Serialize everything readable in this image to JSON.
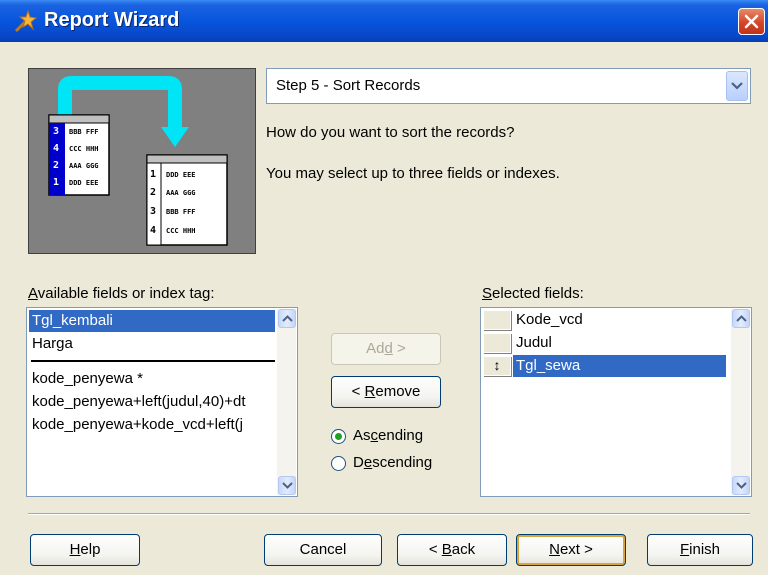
{
  "window": {
    "title": "Report Wizard"
  },
  "step_select": {
    "value": "Step 5 - Sort Records"
  },
  "prompt": "How do you want to sort the records?",
  "hint": "You may select up to three fields or indexes.",
  "graphic": {
    "left_rows": [
      {
        "n": "3",
        "t": "BBB FFF"
      },
      {
        "n": "4",
        "t": "CCC HHH"
      },
      {
        "n": "2",
        "t": "AAA GGG"
      },
      {
        "n": "1",
        "t": "DDD EEE"
      }
    ],
    "right_rows": [
      {
        "n": "1",
        "t": "DDD EEE"
      },
      {
        "n": "2",
        "t": "AAA GGG"
      },
      {
        "n": "3",
        "t": "BBB FFF"
      },
      {
        "n": "4",
        "t": "CCC HHH"
      }
    ]
  },
  "available": {
    "label_u": "A",
    "label_rest": "vailable fields or index tag:",
    "fields": [
      "Tgl_kembali",
      "Harga"
    ],
    "indexes": [
      "kode_penyewa *",
      "kode_penyewa+left(judul,40)+dt",
      "kode_penyewa+kode_vcd+left(j"
    ]
  },
  "selected": {
    "label_u": "S",
    "label_rest": "elected fields:",
    "items": [
      "Kode_vcd",
      "Judul",
      "Tgl_sewa"
    ],
    "move_glyph": "↕"
  },
  "buttons": {
    "add": {
      "pre": "Ad",
      "u": "d",
      "post": " >"
    },
    "remove": {
      "pre": "< ",
      "u": "R",
      "post": "emove"
    },
    "help": {
      "u": "H",
      "post": "elp"
    },
    "cancel": "Cancel",
    "back": {
      "pre": "< ",
      "u": "B",
      "post": "ack"
    },
    "next": {
      "u": "N",
      "post": "ext >"
    },
    "finish": {
      "u": "F",
      "post": "inish"
    }
  },
  "order": {
    "ascending": {
      "pre": "As",
      "u": "c",
      "post": "ending"
    },
    "descending": {
      "pre": "D",
      "u": "e",
      "post": "scending"
    },
    "value": "ascending"
  }
}
